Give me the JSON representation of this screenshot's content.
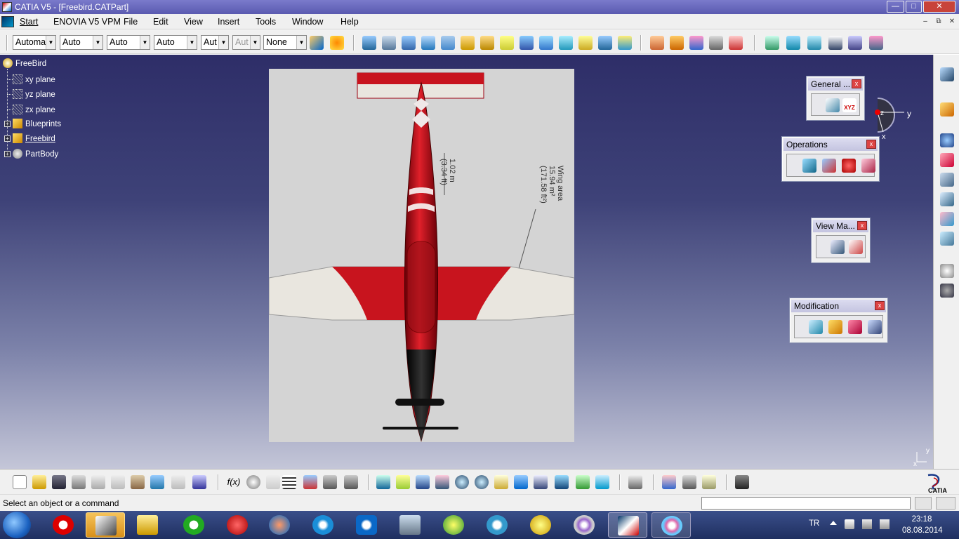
{
  "window": {
    "title": "CATIA V5 - [Freebird.CATPart]",
    "buttons": [
      "minimize",
      "maximize",
      "close"
    ]
  },
  "menubar": {
    "items": [
      "Start",
      "ENOVIA V5 VPM",
      "File",
      "Edit",
      "View",
      "Insert",
      "Tools",
      "Window",
      "Help"
    ]
  },
  "toolbar1": {
    "combos": [
      "Automa",
      "Auto",
      "Auto",
      "Auto",
      "Aut",
      "Aut",
      "None"
    ]
  },
  "tree": {
    "root": "FreeBird",
    "items": [
      "xy plane",
      "yz plane",
      "zx plane",
      "Blueprints",
      "Freebird",
      "PartBody"
    ]
  },
  "blueprint": {
    "dim_text_1": "1.02 m",
    "dim_text_2": "(3.34 ft)",
    "area_title": "Wing area",
    "area_value": "15.94 m²",
    "area_value_ft": "(171.58 ft²)"
  },
  "compass": {
    "axis_y": "y",
    "axis_x": "x",
    "axis_z": "z"
  },
  "corner_axis": {
    "y": "y",
    "x": "x"
  },
  "panels": {
    "general": {
      "title": "General ...",
      "xyz_label": "XYZ"
    },
    "operations": {
      "title": "Operations"
    },
    "viewma": {
      "title": "View Ma..."
    },
    "modification": {
      "title": "Modification"
    }
  },
  "status": {
    "text": "Select an object or a command"
  },
  "catia_logo": "CATIA",
  "taskbar": {
    "language": "TR",
    "time": "23:18",
    "date": "08.08.2014"
  },
  "colors": {
    "workspace_top": "#2e2e68",
    "workspace_bottom": "#c4c6d8",
    "plane_red": "#c8141e",
    "taskbar_bg": "#1f2f60"
  }
}
